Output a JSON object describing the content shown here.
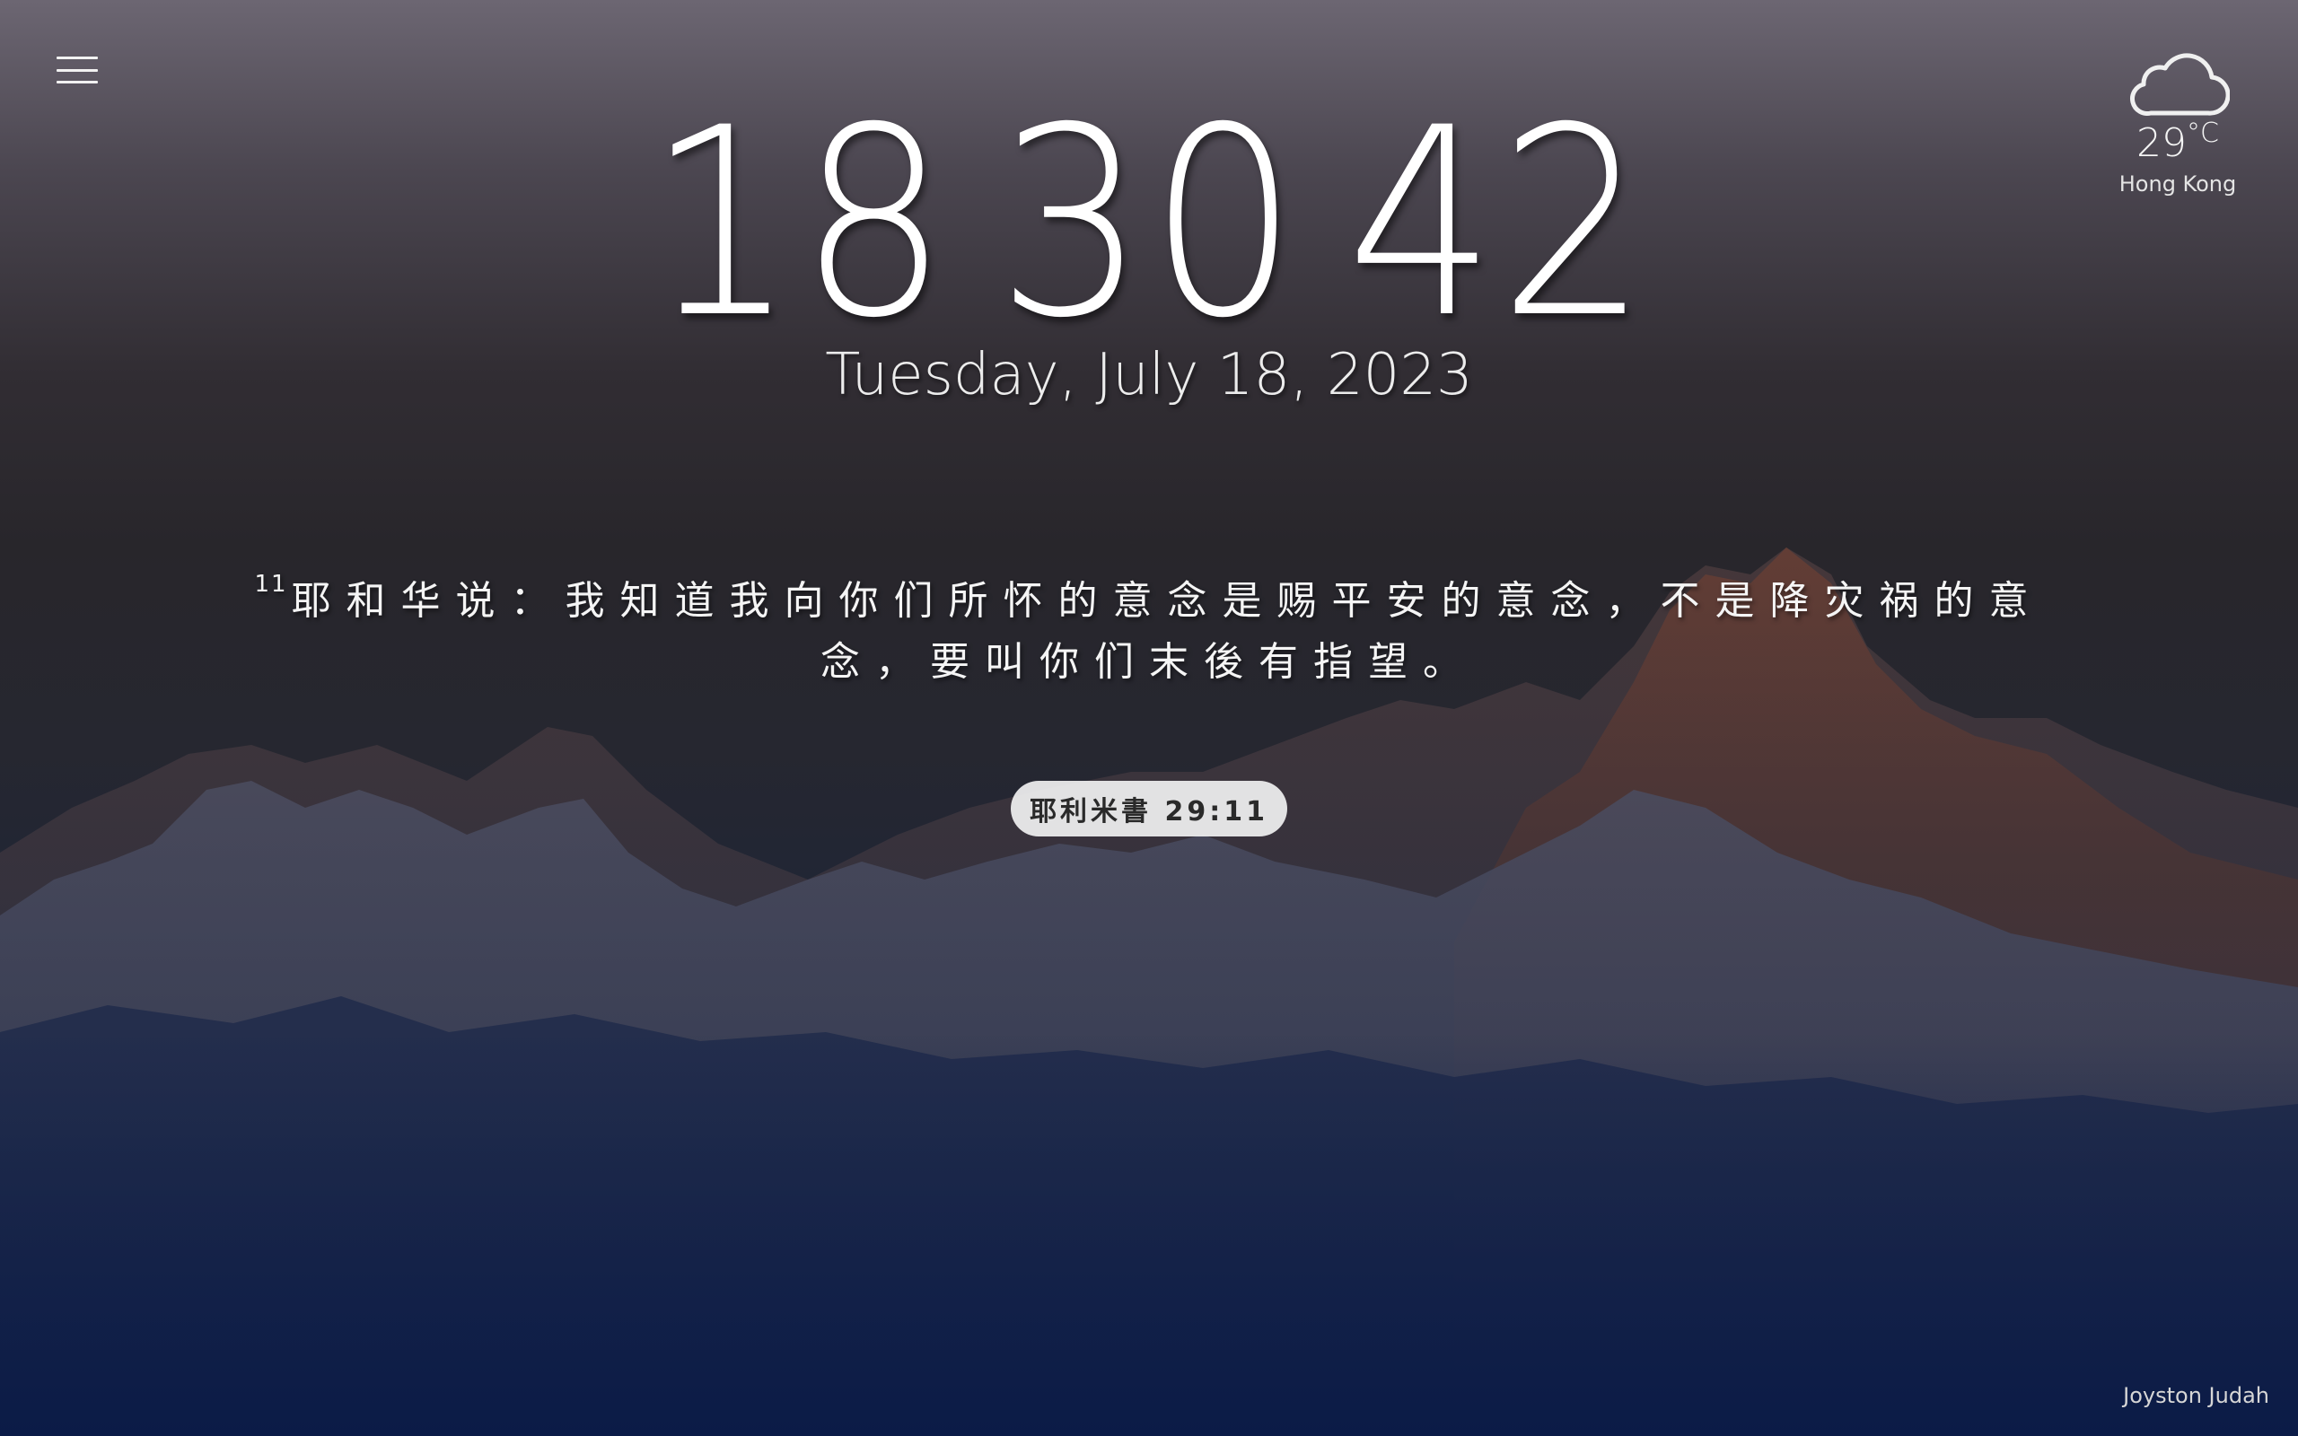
{
  "menu": {
    "icon": "hamburger-menu-icon"
  },
  "weather": {
    "icon": "cloud-icon",
    "temperature": "29",
    "unit": "°C",
    "city": "Hong Kong"
  },
  "clock": {
    "hours": "18",
    "minutes": "30",
    "seconds": "42"
  },
  "date": "Tuesday, July 18, 2023",
  "verse": {
    "number": "11",
    "text": "耶和华说：我知道我向你们所怀的意念是赐平安的意念，不是降灾祸的意念，要叫你们末後有指望。",
    "reference": "耶利米書 29:11"
  },
  "credit": "Joyston Judah",
  "colors": {
    "text": "#ffffff",
    "reference_pill": "#f5f5f5",
    "background_top": "#6c6672",
    "background_bottom": "#0e1d45"
  }
}
